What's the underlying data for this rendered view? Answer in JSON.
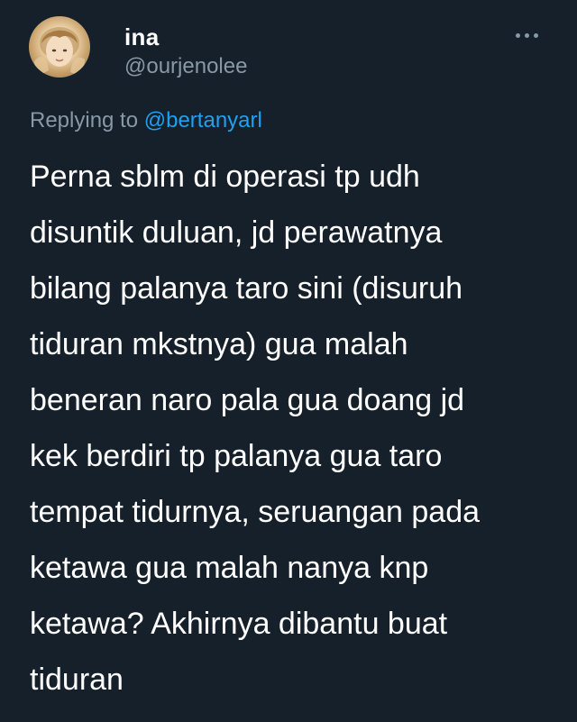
{
  "tweet": {
    "author": {
      "display_name": "ina",
      "handle": "@ourjenolee",
      "avatar_icon": "profile-photo"
    },
    "more_icon": "more-horizontal-icon",
    "reply": {
      "prefix": "Replying to",
      "mention": "@bertanyarl"
    },
    "text_lines": [
      "Perna sblm di operasi tp udh",
      "disuntik duluan, jd perawatnya",
      "bilang palanya taro sini (disuruh",
      "tiduran mkstnya) gua malah",
      "beneran naro pala gua doang jd",
      "kek berdiri tp palanya gua taro",
      "tempat tidurnya, seruangan pada",
      "ketawa gua malah nanya knp",
      "ketawa? Akhirnya dibantu buat",
      "tiduran"
    ]
  },
  "colors": {
    "background": "#15202b",
    "primary_text": "#ffffff",
    "secondary_text": "#8899a6",
    "accent": "#1da1f2"
  }
}
